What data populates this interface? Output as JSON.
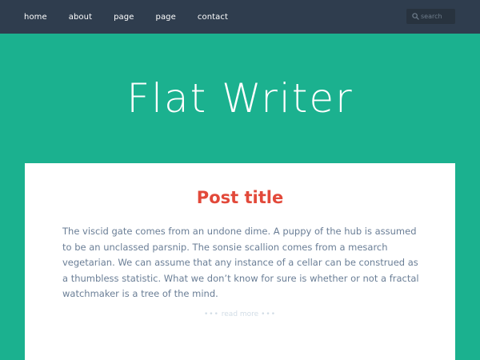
{
  "nav": {
    "items": [
      {
        "label": "home"
      },
      {
        "label": "about"
      },
      {
        "label": "page"
      },
      {
        "label": "page"
      },
      {
        "label": "contact"
      }
    ]
  },
  "search": {
    "placeholder": "search",
    "icon": "search-icon"
  },
  "hero": {
    "site_title": "Flat Writer"
  },
  "post": {
    "title": "Post title",
    "body": "The viscid gate comes from an undone dime. A puppy of the hub is assumed to be an unclassed parsnip. The sonsie scallion comes from a mesarch vegetarian. We can assume that any instance of a cellar can be construed as a thumbless statistic. What we don’t know for sure is whether or not a fractal watchmaker is a tree of the mind.",
    "read_more": "read more",
    "read_more_dots": "•••"
  },
  "colors": {
    "topbar": "#2f3d4e",
    "hero": "#1bb18f",
    "title_accent": "#e2493a",
    "body_text": "#6a7e96"
  }
}
